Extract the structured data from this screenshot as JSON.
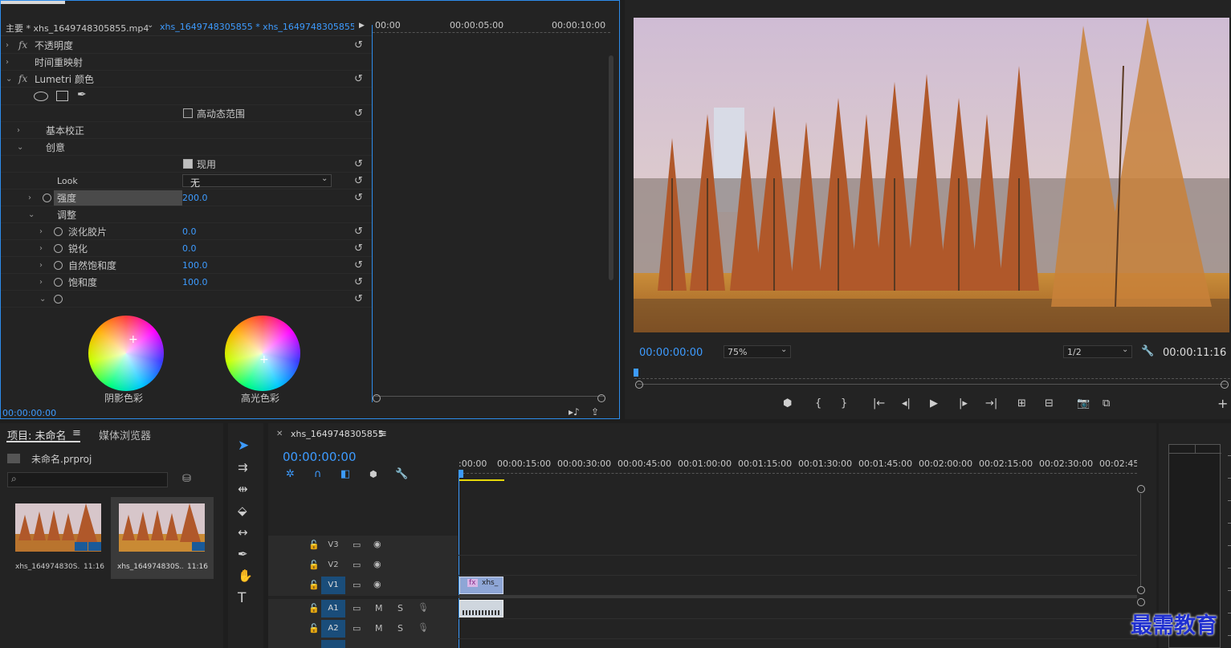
{
  "effect_controls": {
    "source_label": "主要 * xhs_1649748305855.mp4",
    "sequence_label": "xhs_1649748305855 * xhs_1649748305855...",
    "ruler": [
      "00:00",
      "00:00:05:00",
      "00:00:10:00"
    ],
    "rows": {
      "opacity": "不透明度",
      "time_remap": "时间重映射",
      "lumetri": "Lumetri 颜色",
      "hdr": "高动态范围",
      "basic": "基本校正",
      "creative": "创意",
      "enable": "现用",
      "look_label": "Look",
      "look_value": "无",
      "intensity_label": "强度",
      "intensity_value": "200.0",
      "adjust": "调整",
      "faded_film": "淡化胶片",
      "faded_film_value": "0.0",
      "sharpen": "锐化",
      "sharpen_value": "0.0",
      "vibrance": "自然饱和度",
      "vibrance_value": "100.0",
      "saturation": "饱和度",
      "saturation_value": "100.0"
    },
    "wheel_shadow": "阴影色彩",
    "wheel_highlight": "高光色彩",
    "timecode": "00:00:00:00"
  },
  "program_monitor": {
    "timecode": "00:00:00:00",
    "zoom": "75%",
    "resolution": "1/2",
    "duration": "00:00:11:16"
  },
  "project": {
    "tab_project": "项目: 未命名",
    "tab_media": "媒体浏览器",
    "file": "未命名.prproj",
    "items": [
      {
        "name": "xhs_164974830S...",
        "duration": "11:16"
      },
      {
        "name": "xhs_164974830S...",
        "duration": "11:16"
      }
    ]
  },
  "timeline": {
    "sequence": "xhs_1649748305855",
    "timecode": "00:00:00:00",
    "ruler": [
      ":00:00",
      "00:00:15:00",
      "00:00:30:00",
      "00:00:45:00",
      "00:01:00:00",
      "00:01:15:00",
      "00:01:30:00",
      "00:01:45:00",
      "00:02:00:00",
      "00:02:15:00",
      "00:02:30:00",
      "00:02:45:0"
    ],
    "tracks": [
      "V3",
      "V2",
      "V1",
      "A1",
      "A2"
    ],
    "clip_label": "xhs_",
    "mute": "M",
    "solo": "S"
  },
  "watermark": "最需教育"
}
